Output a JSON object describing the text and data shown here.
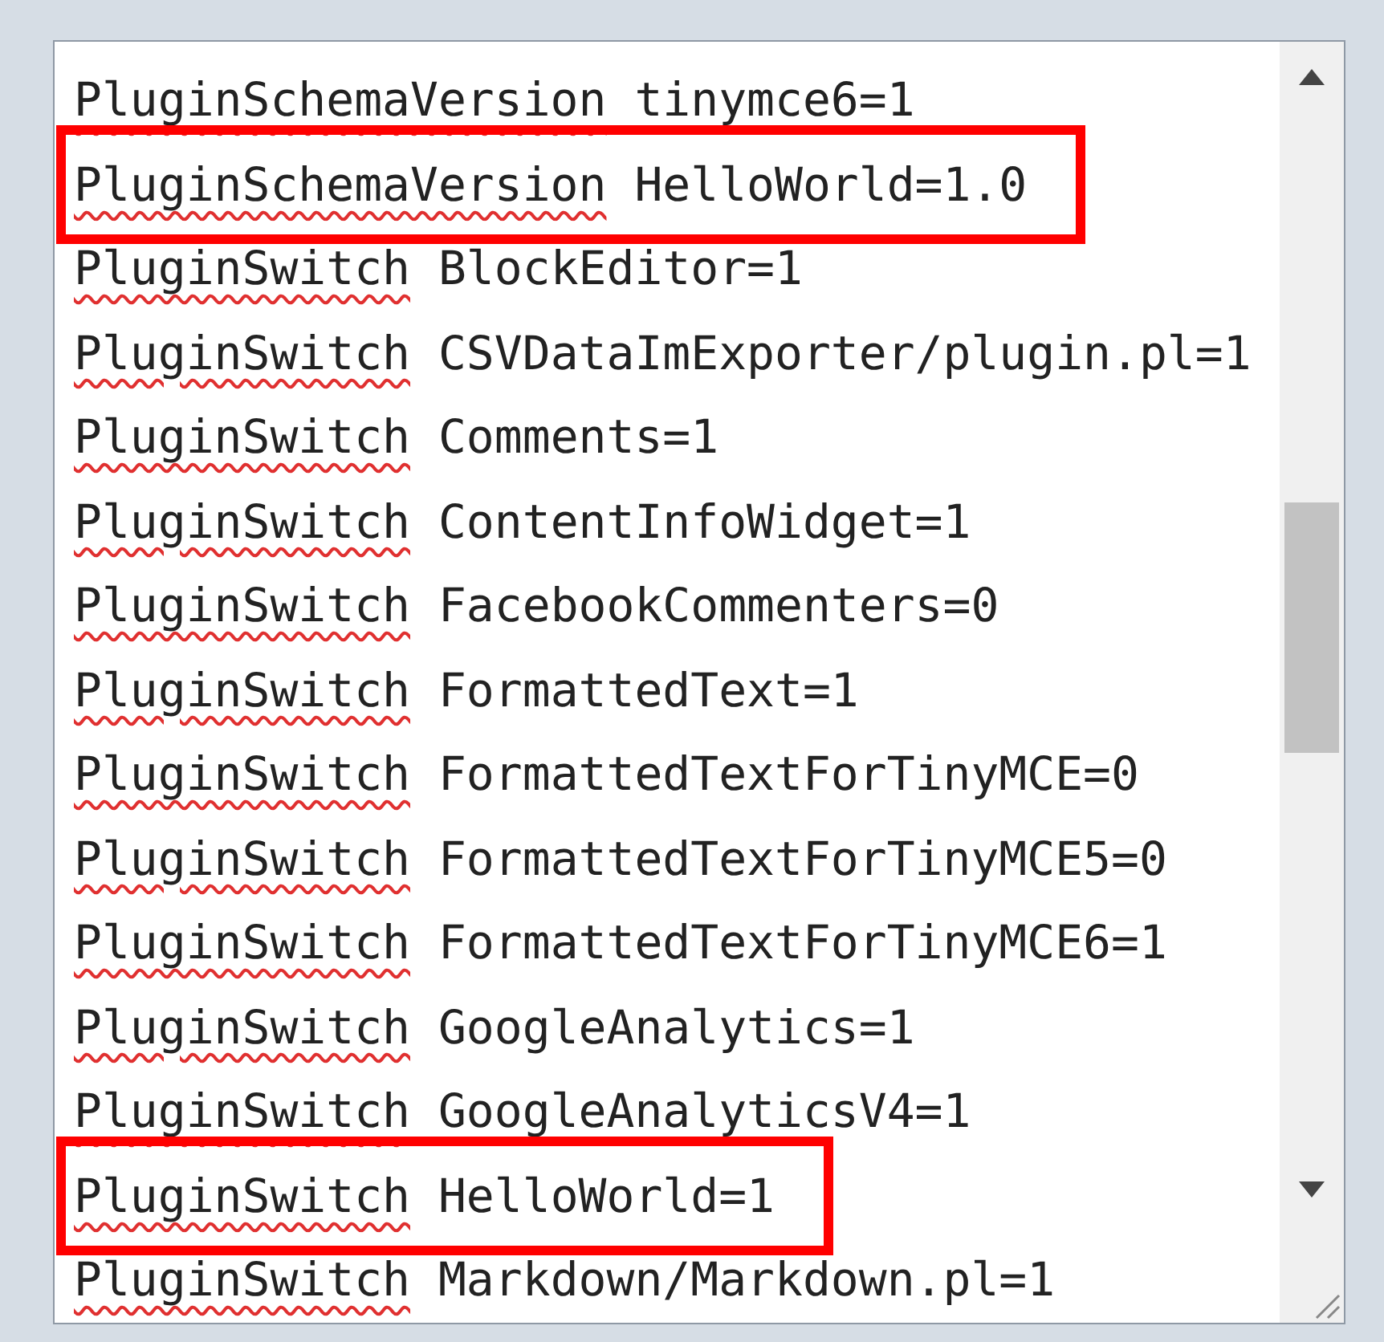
{
  "lines": [
    {
      "text": "PluginSchemaVersion tinymce6=1",
      "highlighted": false
    },
    {
      "text": "PluginSchemaVersion HelloWorld=1.0",
      "highlighted": true
    },
    {
      "text": "PluginSwitch BlockEditor=1",
      "highlighted": false
    },
    {
      "text": "PluginSwitch CSVDataImExporter/plugin.pl=1",
      "highlighted": false
    },
    {
      "text": "PluginSwitch Comments=1",
      "highlighted": false
    },
    {
      "text": "PluginSwitch ContentInfoWidget=1",
      "highlighted": false
    },
    {
      "text": "PluginSwitch FacebookCommenters=0",
      "highlighted": false
    },
    {
      "text": "PluginSwitch FormattedText=1",
      "highlighted": false
    },
    {
      "text": "PluginSwitch FormattedTextForTinyMCE=0",
      "highlighted": false
    },
    {
      "text": "PluginSwitch FormattedTextForTinyMCE5=0",
      "highlighted": false
    },
    {
      "text": "PluginSwitch FormattedTextForTinyMCE6=1",
      "highlighted": false
    },
    {
      "text": "PluginSwitch GoogleAnalytics=1",
      "highlighted": false
    },
    {
      "text": "PluginSwitch GoogleAnalyticsV4=1",
      "highlighted": false
    },
    {
      "text": "PluginSwitch HelloWorld=1",
      "highlighted": true
    },
    {
      "text": "PluginSwitch Markdown/Markdown.pl=1",
      "highlighted": false
    }
  ]
}
